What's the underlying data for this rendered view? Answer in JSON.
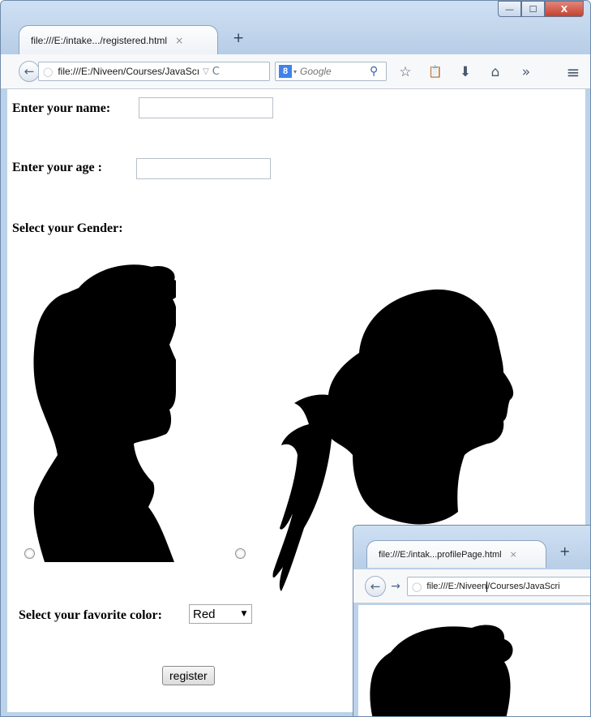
{
  "main_window": {
    "tab": {
      "title": "file:///E:/intake.../registered.html",
      "close": "×"
    },
    "new_tab": "+",
    "controls": {
      "minimize": "—",
      "maximize": "☐",
      "close": "X"
    },
    "address_bar": {
      "url": "file:///E:/Niveen/Courses/JavaScı",
      "dropdown": "▽",
      "reload": "C"
    },
    "search": {
      "engine_badge": "8",
      "dropdown": "▾",
      "placeholder": "Google",
      "button": "⚲"
    },
    "toolbar_icons": {
      "bookmark": "☆",
      "clipboard": "📋",
      "download": "⬇",
      "home": "⌂",
      "overflow": "»",
      "menu": "≡"
    }
  },
  "form": {
    "name_label": "Enter your name:",
    "name_value": "",
    "age_label": "Enter your age :",
    "age_value": "",
    "gender_label": "Select your Gender:",
    "genders": [
      "male",
      "female"
    ],
    "color_label": "Select your favorite color:",
    "color_options": [
      "Red"
    ],
    "color_selected": "Red",
    "register_label": "register"
  },
  "second_window": {
    "tab": {
      "title": "file:///E:/intak...profilePage.html",
      "close": "×"
    },
    "new_tab": "+",
    "address_bar": {
      "url_before_caret": "file:///E:/Niveen",
      "url_after_caret": "/Courses/JavaScri"
    },
    "nav": {
      "back": "←",
      "forward": "→"
    }
  }
}
